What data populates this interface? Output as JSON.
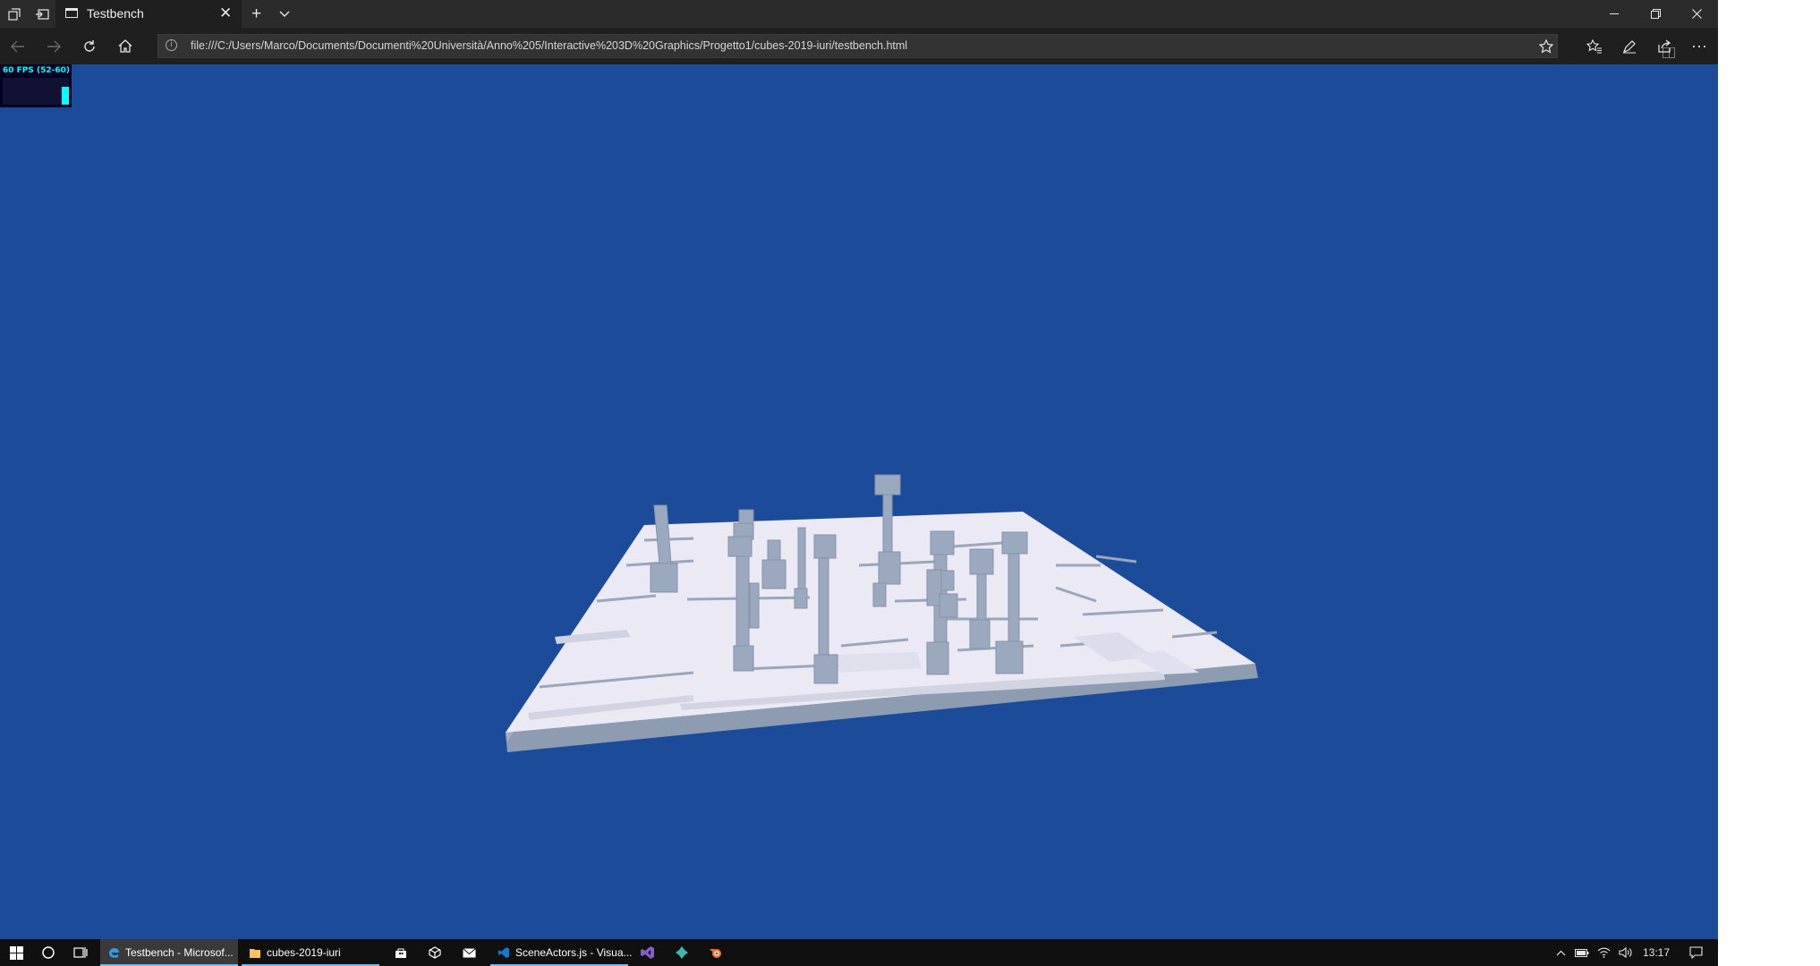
{
  "browser": {
    "tab": {
      "title": "Testbench"
    },
    "tab_bar_icons": [
      "tab-preview-icon",
      "set-aside-tabs-icon",
      "new-tab-icon",
      "tab-list-chevron-icon"
    ],
    "address": {
      "url": "file:///C:/Users/Marco/Documents/Documenti%20Università/Anno%205/Interactive%203D%20Graphics/Progetto1/cubes-2019-iuri/testbench.html"
    },
    "toolbar_icons": [
      "favorites-icon",
      "pen-icon",
      "share-icon",
      "more-icon"
    ],
    "more_label": "···"
  },
  "viewport": {
    "background_color": "#1c4b99",
    "stats": {
      "fps_text": "60 FPS (52-60)",
      "fps_value": 60,
      "fps_min": 52,
      "fps_max": 60
    },
    "scene": {
      "description_colors": {
        "floor_top": "#eceaf5",
        "floor_side": "#8c9bb0",
        "pillar": "#9aa9bd"
      }
    }
  },
  "taskbar": {
    "items": [
      {
        "label": "Testbench - Microsof...",
        "icon": "edge-icon",
        "active": true
      },
      {
        "label": "cubes-2019-iuri",
        "icon": "folder-icon",
        "active": false
      },
      {
        "label": "SceneActors.js - Visua...",
        "icon": "vscode-icon",
        "active": false
      }
    ],
    "pinned_icons": [
      "store-icon",
      "unity-icon",
      "mail-icon",
      "visual-studio-icon",
      "app-icon",
      "blender-icon"
    ],
    "clock": "13:17"
  }
}
